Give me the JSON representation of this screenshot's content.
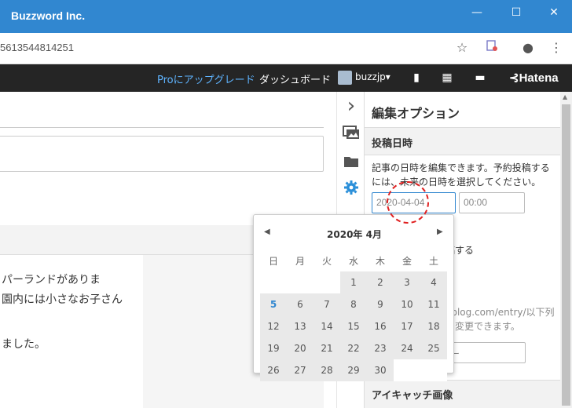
{
  "window": {
    "title": "Buzzword Inc.",
    "min_glyph": "—",
    "max_glyph": "☐",
    "close_glyph": "✕"
  },
  "browser": {
    "url": "5613544814251",
    "icons": [
      "star-icon",
      "extension-icon",
      "profile-icon",
      "menu-icon"
    ],
    "star_glyph": "☆",
    "profile_glyph": "●",
    "menu_glyph": "⋮"
  },
  "hatena_nav": {
    "pro_upgrade": "Proにアップグレード",
    "dashboard": "ダッシュボード",
    "username": "buzzjp",
    "user_caret": "▾",
    "brand": "Hatena",
    "brand_mark": "⊰",
    "bookmark_glyph": "▮",
    "apps_glyph": "▦",
    "notify_glyph": "▬"
  },
  "editor": {
    "line1": "パーランドがありま",
    "line2": "園内には小さなお子さん",
    "line3": "ました。"
  },
  "toolbar": {
    "collapse_glyph": "›",
    "icons": [
      "chevron-right-icon",
      "image-icon",
      "folder-icon",
      "gear-icon"
    ]
  },
  "panel": {
    "title": "編集オプション",
    "section_posted_date": "投稿日時",
    "description": "記事の日時を編集できます。予約投稿するには、未来の日時を選択してください。",
    "date_value": "2020-04-04",
    "time_value": "00:00",
    "reserve_label": "稿する",
    "url_hint": "ablog.com/entry/以下列に変更できます。",
    "url_field_value": "ー",
    "eyecatch_heading": "アイキャッチ画像"
  },
  "calendar": {
    "month_label": "2020年 4月",
    "prev_glyph": "◀",
    "next_glyph": "▶",
    "weekdays": [
      "日",
      "月",
      "火",
      "水",
      "木",
      "金",
      "土"
    ],
    "weeks": [
      [
        "",
        "",
        "",
        "1",
        "2",
        "3",
        "4"
      ],
      [
        "5",
        "6",
        "7",
        "8",
        "9",
        "10",
        "11"
      ],
      [
        "12",
        "13",
        "14",
        "15",
        "16",
        "17",
        "18"
      ],
      [
        "19",
        "20",
        "21",
        "22",
        "23",
        "24",
        "25"
      ],
      [
        "26",
        "27",
        "28",
        "29",
        "30",
        "",
        ""
      ]
    ],
    "today": "5"
  },
  "colors": {
    "titlebar": "#3187d0",
    "nav": "#252525",
    "pro_link": "#5fb4ff",
    "annotation": "#e02020"
  }
}
